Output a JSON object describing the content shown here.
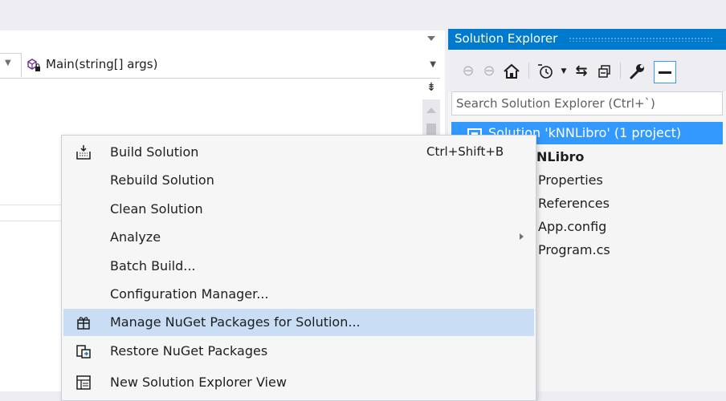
{
  "editor": {
    "member_dropdown": "Main(string[] args)"
  },
  "solution_explorer": {
    "title": "Solution Explorer",
    "search_placeholder": "Search Solution Explorer (Ctrl+`)",
    "tree": [
      {
        "label": "Solution 'kNNLibro' (1 project)",
        "selected": true
      },
      {
        "label": "NLibro",
        "bold": true
      },
      {
        "label": "Properties"
      },
      {
        "label": "References"
      },
      {
        "label": "App.config"
      },
      {
        "label": "Program.cs"
      }
    ],
    "toolbar_icons": [
      "back-icon",
      "forward-icon",
      "home-icon",
      "history-icon",
      "dropdown-icon",
      "sync-icon",
      "collapse-all-icon",
      "properties-wrench-icon",
      "pin-icon"
    ]
  },
  "context_menu": {
    "items": [
      {
        "label": "Build Solution",
        "shortcut": "Ctrl+Shift+B",
        "icon": "build-solution-icon"
      },
      {
        "label": "Rebuild Solution"
      },
      {
        "label": "Clean Solution"
      },
      {
        "label": "Analyze",
        "submenu": true
      },
      {
        "label": "Batch Build..."
      },
      {
        "label": "Configuration Manager..."
      },
      {
        "label": "Manage NuGet Packages for Solution...",
        "icon": "nuget-package-icon",
        "hover": true
      },
      {
        "label": "Restore NuGet Packages",
        "icon": "restore-packages-icon"
      },
      {
        "label": "New Solution Explorer View",
        "icon": "new-view-icon"
      }
    ]
  },
  "colors": {
    "accent": "#007acc",
    "selection": "#3399ff",
    "menu_hover": "#c9def5"
  }
}
